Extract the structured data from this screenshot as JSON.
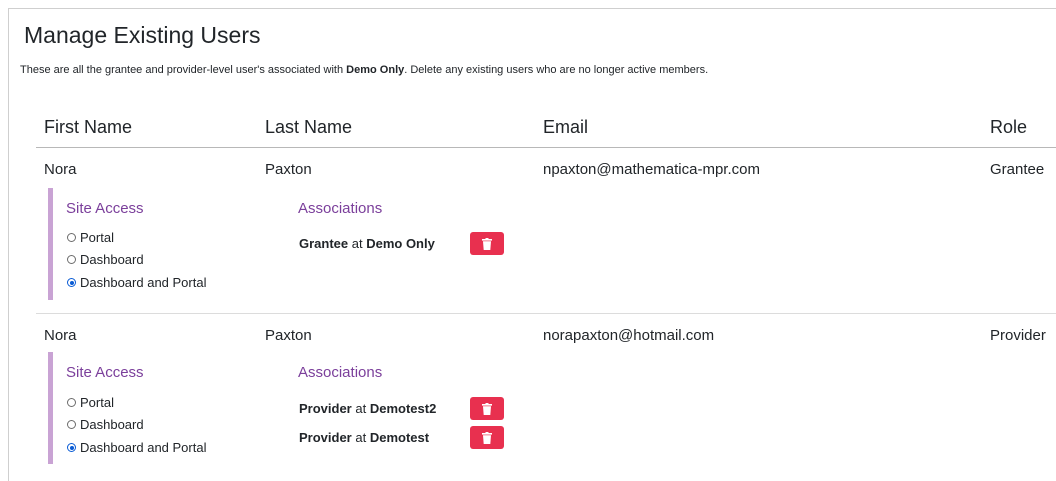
{
  "page": {
    "title": "Manage Existing Users",
    "description_pre": "These are all the grantee and provider-level user's associated with ",
    "description_org": "Demo Only",
    "description_post": ". Delete any existing users who are no longer active members."
  },
  "table": {
    "headers": [
      "First Name",
      "Last Name",
      "Email",
      "Role"
    ],
    "users": [
      {
        "first": "Nora",
        "last": "Paxton",
        "email": "npaxton@mathematica-mpr.com",
        "role": "Grantee",
        "site_access_title": "Site Access",
        "site_access_options": [
          "Portal",
          "Dashboard",
          "Dashboard and Portal"
        ],
        "site_access_selected": "Dashboard and Portal",
        "associations_title": "Associations",
        "associations": [
          {
            "role": "Grantee",
            "at": " at ",
            "org": "Demo Only"
          }
        ]
      },
      {
        "first": "Nora",
        "last": "Paxton",
        "email": "norapaxton@hotmail.com",
        "role": "Provider",
        "site_access_title": "Site Access",
        "site_access_options": [
          "Portal",
          "Dashboard",
          "Dashboard and Portal"
        ],
        "site_access_selected": "Dashboard and Portal",
        "associations_title": "Associations",
        "associations": [
          {
            "role": "Provider",
            "at": " at ",
            "org": "Demotest2"
          },
          {
            "role": "Provider",
            "at": " at ",
            "org": "Demotest"
          }
        ]
      }
    ]
  },
  "icons": {
    "delete": "trash-icon"
  },
  "colors": {
    "accent_purple": "#7b3f9b",
    "sidebar_bar": "#c9a3d4",
    "delete_red": "#e8304f",
    "radio_blue": "#0a5cd5"
  }
}
